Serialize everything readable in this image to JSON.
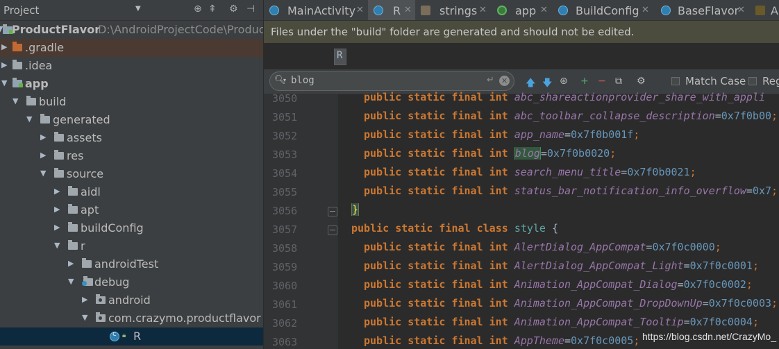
{
  "project_panel": {
    "title": "Project",
    "tree": [
      {
        "label": "ProductFlavor",
        "sub": "D:\\AndroidProjectCode\\Produc"
      },
      {
        "label": ".gradle"
      },
      {
        "label": ".idea"
      },
      {
        "label": "app"
      },
      {
        "label": "build"
      },
      {
        "label": "generated"
      },
      {
        "label": "assets"
      },
      {
        "label": "res"
      },
      {
        "label": "source"
      },
      {
        "label": "aidl"
      },
      {
        "label": "apt"
      },
      {
        "label": "buildConfig"
      },
      {
        "label": "r"
      },
      {
        "label": "androidTest"
      },
      {
        "label": "debug"
      },
      {
        "label": "android"
      },
      {
        "label": "com.crazymo.productflavor"
      },
      {
        "label": "R"
      }
    ]
  },
  "tabs": [
    {
      "label": "MainActivity",
      "icon": "class-icon"
    },
    {
      "label": "R",
      "icon": "class-icon",
      "active": true
    },
    {
      "label": "strings",
      "icon": "xml-icon"
    },
    {
      "label": "app",
      "icon": "gradle-icon"
    },
    {
      "label": "BuildConfig",
      "icon": "class-icon"
    },
    {
      "label": "BaseFlavor",
      "icon": "class-icon"
    },
    {
      "label": "A",
      "icon": "xml-icon"
    }
  ],
  "banner": {
    "text": "Files under the \"build\" folder are generated and should not be edited."
  },
  "breadcrumb": {
    "label": "R"
  },
  "search": {
    "query": "blog",
    "match_case_label": "Match Case",
    "regex_label": "Reg"
  },
  "editor": {
    "lines": [
      {
        "no": "3050",
        "field": "abc_shareactionprovider_share_with_appli",
        "value": ""
      },
      {
        "no": "3051",
        "field": "abc_toolbar_collapse_description",
        "value": "=0x7f0b00"
      },
      {
        "no": "3052",
        "field": "app_name",
        "value": "=0x7f0b001f"
      },
      {
        "no": "3053",
        "field": "blog",
        "value": "=0x7f0b0020"
      },
      {
        "no": "3054",
        "field": "search_menu_title",
        "value": "=0x7f0b0021"
      },
      {
        "no": "3055",
        "field": "status_bar_notification_info_overflow",
        "value": "=0x7"
      },
      {
        "no": "3056",
        "text": "}"
      },
      {
        "no": "3057",
        "text": "public static final class",
        "name": "style",
        "tail": "{"
      },
      {
        "no": "3058",
        "field": "AlertDialog_AppCompat",
        "value": "=0x7f0c0000"
      },
      {
        "no": "3059",
        "field": "AlertDialog_AppCompat_Light",
        "value": "=0x7f0c0001"
      },
      {
        "no": "3060",
        "field": "Animation_AppCompat_Dialog",
        "value": "=0x7f0c0002"
      },
      {
        "no": "3061",
        "field": "Animation_AppCompat_DropDownUp",
        "value": "=0x7f0c0003"
      },
      {
        "no": "3062",
        "field": "Animation_AppCompat_Tooltip",
        "value": "=0x7f0c0004"
      },
      {
        "no": "3063",
        "field": "AppTheme",
        "value": "=0x7f0c0005"
      }
    ],
    "modifier": "public static final int",
    "semicolon": ";"
  },
  "watermark": "https://blog.csdn.net/CrazyMo_"
}
